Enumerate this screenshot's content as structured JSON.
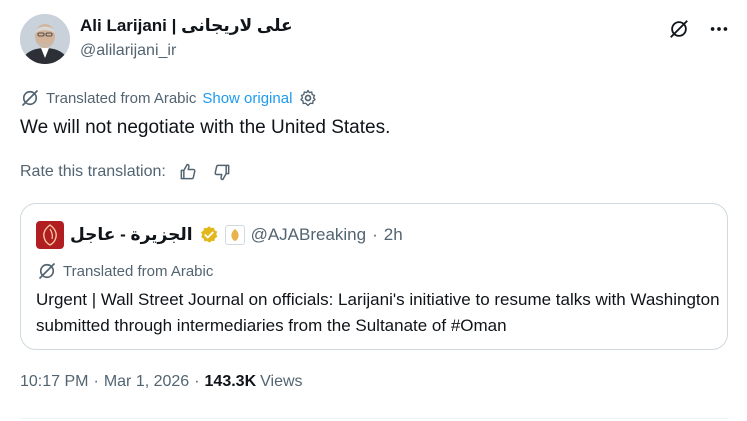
{
  "author": {
    "display_name": "Ali Larijani | علی لاریجانی",
    "handle": "@alilarijani_ir",
    "avatar_icon": "profile-photo"
  },
  "header_actions": {
    "grok_icon": "grok-icon",
    "more_icon": "more-icon"
  },
  "translation": {
    "label": "Translated from Arabic",
    "show_original": "Show original",
    "settings_icon": "gear-icon"
  },
  "tweet": {
    "text": "We will not negotiate with the United States."
  },
  "rating": {
    "label": "Rate this translation:",
    "thumbs_up_icon": "thumbs-up-icon",
    "thumbs_down_icon": "thumbs-down-icon"
  },
  "quote": {
    "display_name": "الجزيرة - عاجل",
    "handle": "@AJABreaking",
    "separator": "·",
    "time": "2h",
    "translated_label": "Translated from Arabic",
    "text": "Urgent | Wall Street Journal on officials: Larijani's initiative to resume talks with Washington submitted through intermediaries from the Sultanate of #Oman",
    "verified_color": "#e2b719"
  },
  "meta": {
    "time": "10:17 PM",
    "separator": "·",
    "date": "Mar 1, 2026",
    "views_count": "143.3K",
    "views_label": "Views"
  },
  "colors": {
    "text": "#0f1419",
    "secondary": "#536471",
    "link": "#1d9bf0",
    "border": "#cfd9de",
    "aj_red": "#b11e22"
  }
}
